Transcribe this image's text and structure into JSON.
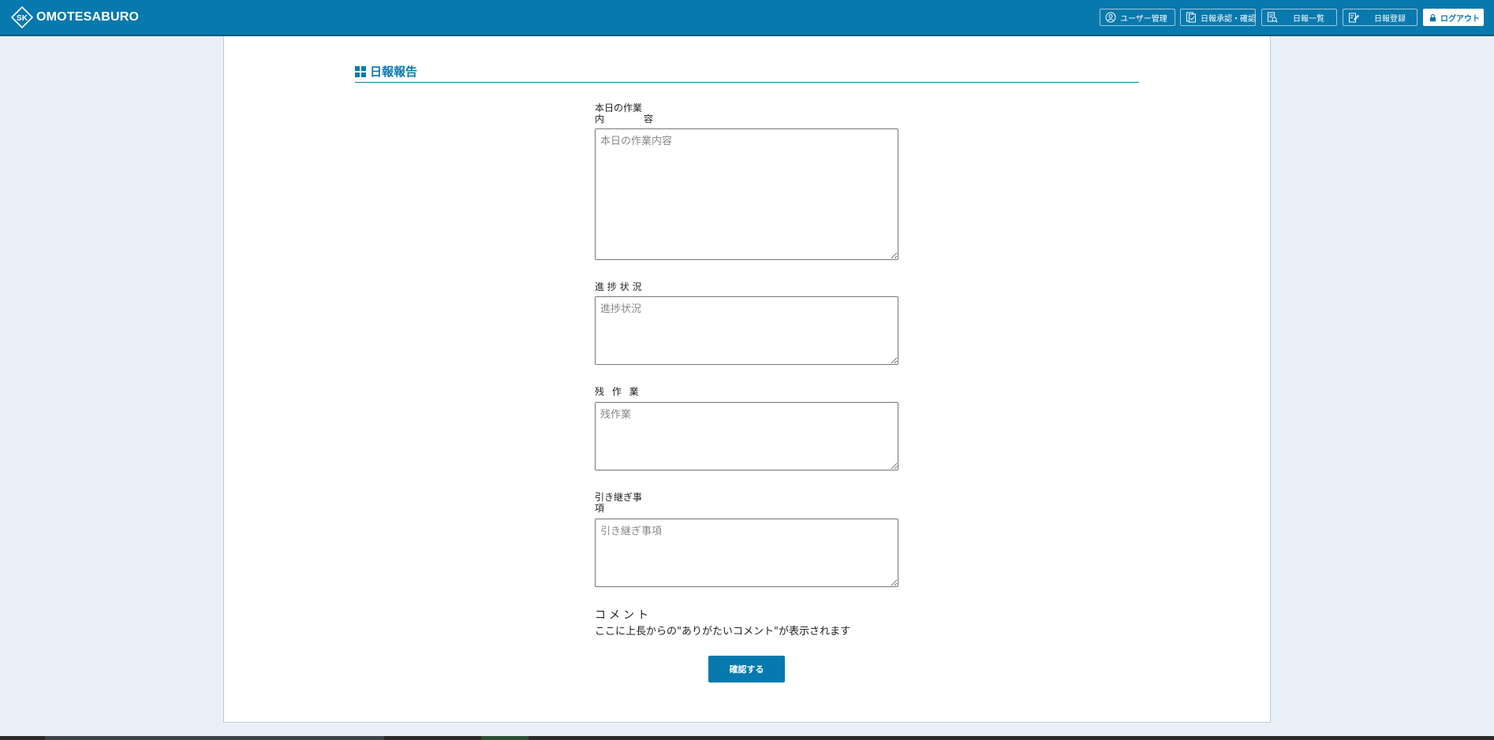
{
  "app": {
    "brand": "OMOTESABURO"
  },
  "nav": {
    "user_admin": "ユーザー管理",
    "report_approval": "日報承認・確認",
    "report_list": "日報一覧",
    "report_register": "日報登録",
    "logout": "ログアウト"
  },
  "page": {
    "title": "日報報告"
  },
  "fields": {
    "today_work": {
      "label_line1": "本日の作業",
      "label_line2a": "内",
      "label_line2b": "容",
      "placeholder": "本日の作業内容"
    },
    "progress": {
      "label": "進 捗 状 況",
      "placeholder": "進捗状況"
    },
    "remaining": {
      "label": "残 作 業",
      "placeholder": "残作業"
    },
    "handover": {
      "label_line1": "引き継ぎ事",
      "label_line2": "項",
      "placeholder": "引き継ぎ事項"
    }
  },
  "comment": {
    "heading": "コメント",
    "text": "ここに上長からの\"ありがたいコメント\"が表示されます"
  },
  "actions": {
    "confirm": "確認する"
  },
  "colors": {
    "primary": "#0879ae",
    "background": "#e8eff6"
  }
}
